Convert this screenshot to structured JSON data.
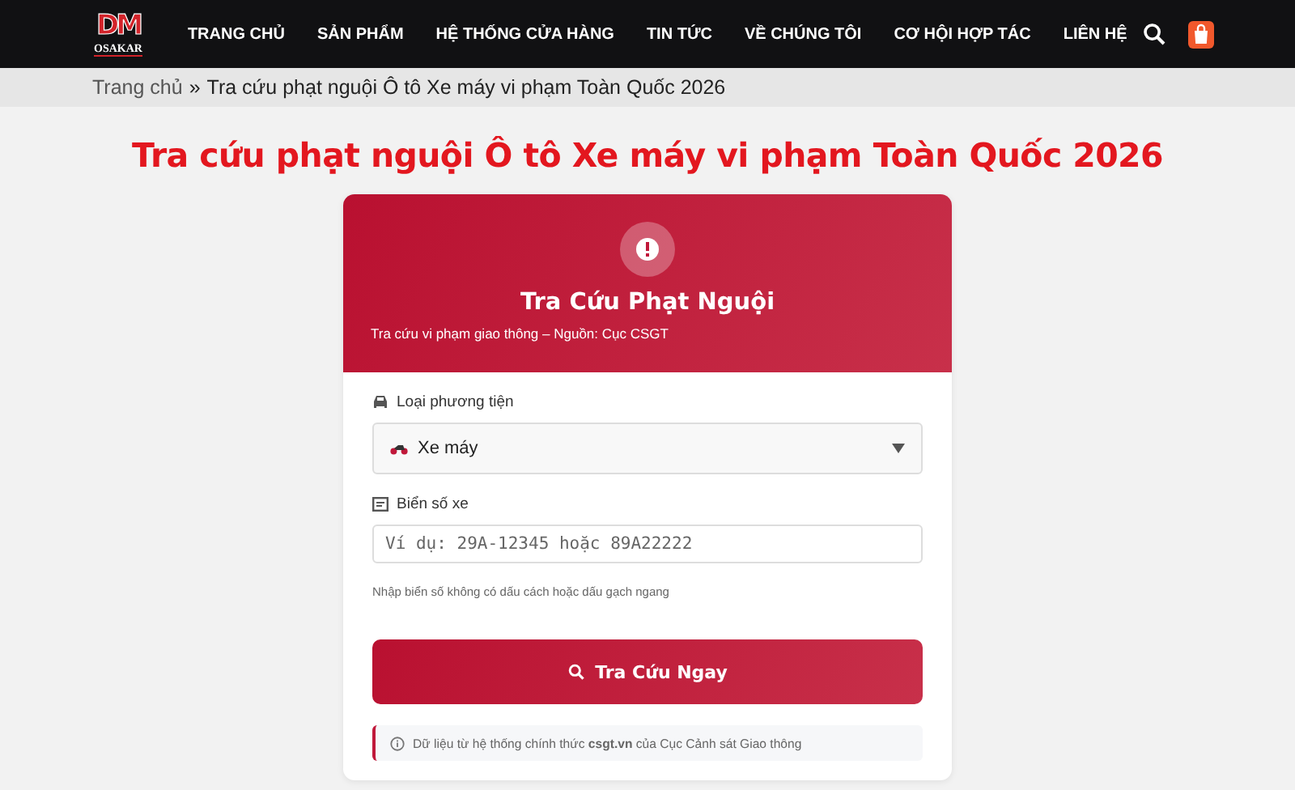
{
  "header": {
    "logo": {
      "mark": "DM",
      "name": "OSAKAR"
    },
    "nav": [
      "TRANG CHỦ",
      "SẢN PHẨM",
      "HỆ THỐNG CỬA HÀNG",
      "TIN TỨC",
      "VỀ CHÚNG TÔI",
      "CƠ HỘI HỢP TÁC",
      "LIÊN HỆ"
    ]
  },
  "breadcrumb": {
    "home": "Trang chủ",
    "separator": "»",
    "current": "Tra cứu phạt nguội Ô tô Xe máy vi phạm Toàn Quốc 2026"
  },
  "page_title": "Tra cứu phạt nguội Ô tô Xe máy vi phạm Toàn Quốc 2026",
  "card": {
    "title": "Tra Cứu Phạt Nguội",
    "subtitle": "Tra cứu vi phạm giao thông – Nguồn: Cục CSGT",
    "vehicle_label": "Loại phương tiện",
    "vehicle_value": "Xe máy",
    "plate_label": "Biển số xe",
    "plate_placeholder": "Ví dụ: 29A-12345 hoặc 89A22222",
    "hint": "Nhập biển số không có dấu cách hoặc dấu gạch ngang",
    "button": "Tra Cứu Ngay",
    "note": "Dữ liệu từ hệ thống chính thức **csgt.vn** của Cục Cảnh sát Giao thông"
  }
}
